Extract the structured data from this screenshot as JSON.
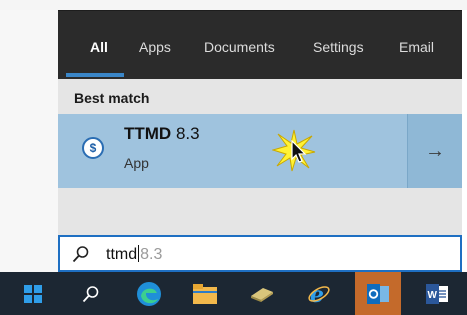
{
  "tabs": [
    "All",
    "Apps",
    "Documents",
    "Settings",
    "Email"
  ],
  "results": {
    "section_label": "Best match",
    "item": {
      "name_bold": "TTMD",
      "name_rest": " 8.3",
      "type": "App"
    }
  },
  "search": {
    "query": "ttmd",
    "hint": "8.3"
  },
  "icons": {
    "start": "windows-start-icon",
    "search": "search-icon",
    "edge": "edge-icon",
    "files": "file-explorer-icon",
    "app": "ttmd-app-icon",
    "ie": "internet-explorer-icon",
    "outlook": "outlook-icon",
    "word": "word-icon",
    "arrow": "arrow-right-icon"
  },
  "colors": {
    "panel_bg": "#2b2b2b",
    "accent": "#3a86c8",
    "result_bg": "#e5e5e5",
    "selected_bg": "#9fc3de",
    "taskbar_bg": "#1c2733"
  }
}
